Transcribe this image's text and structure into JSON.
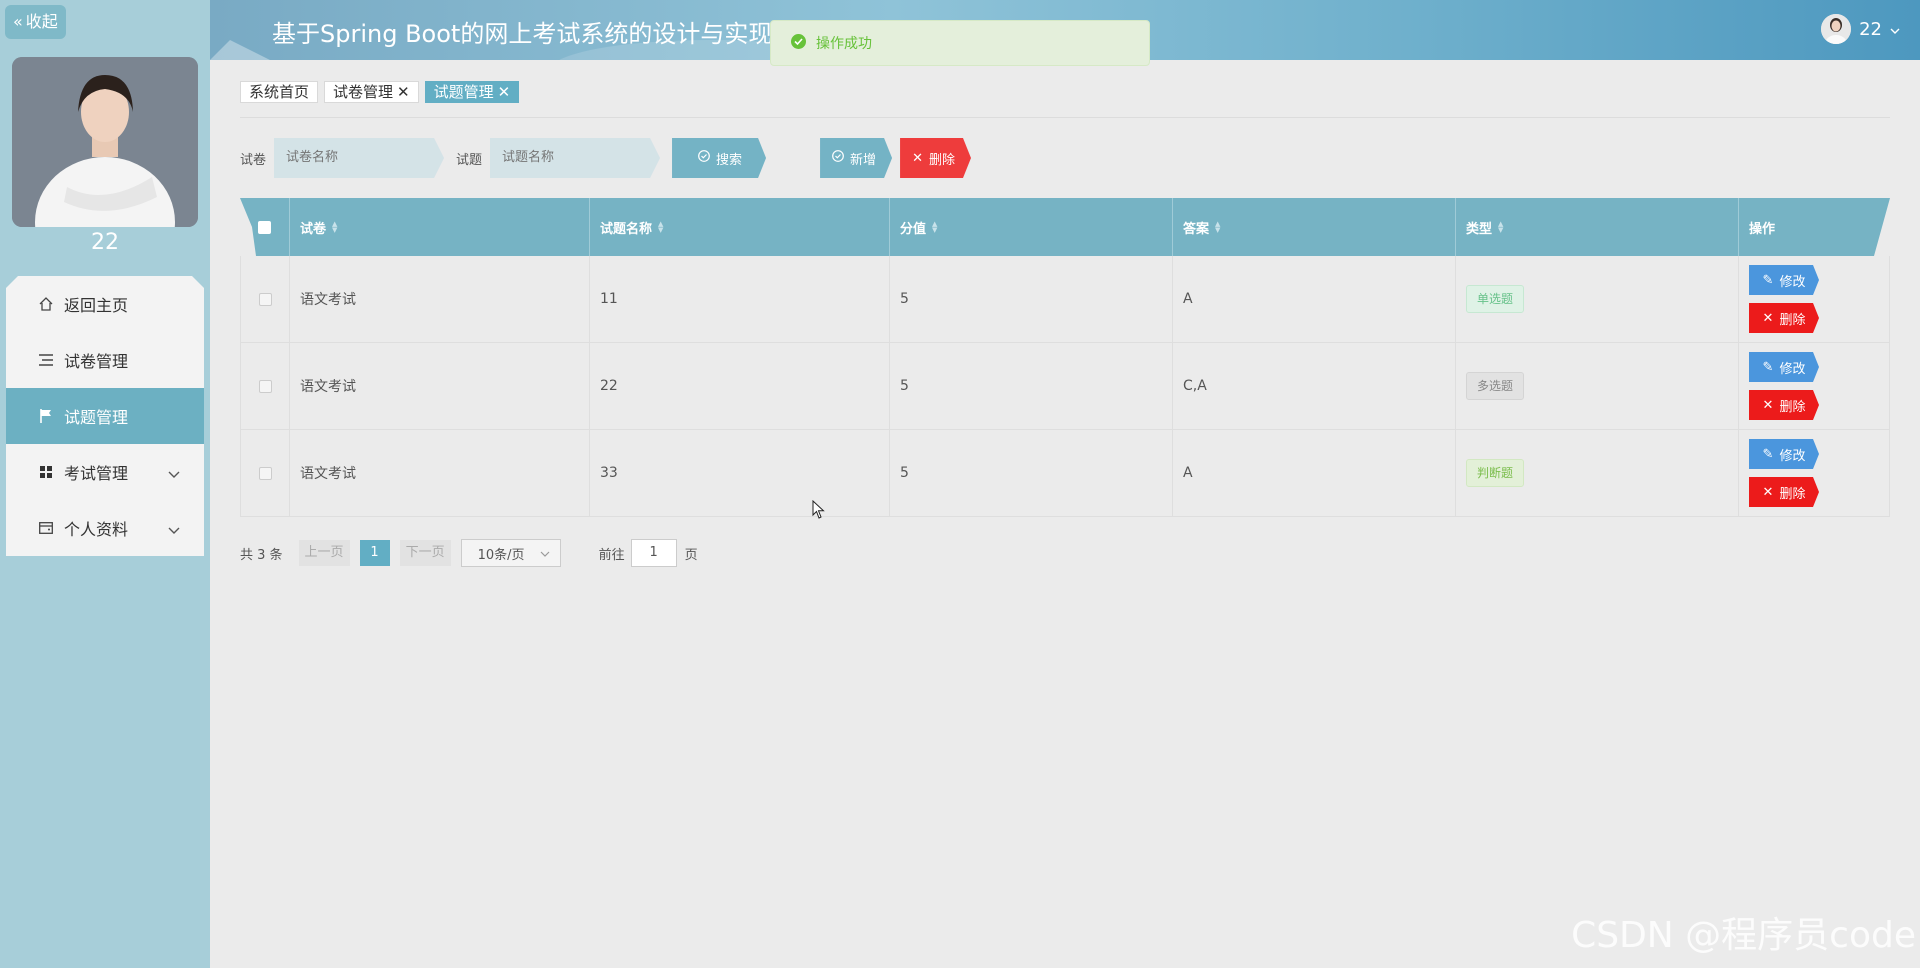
{
  "sidebar": {
    "collapse_label": "收起",
    "username": "22",
    "items": [
      {
        "label": "返回主页",
        "icon": "home-icon"
      },
      {
        "label": "试卷管理",
        "icon": "list-icon"
      },
      {
        "label": "试题管理",
        "icon": "flag-icon",
        "active": true
      },
      {
        "label": "考试管理",
        "icon": "grid-icon",
        "expandable": true
      },
      {
        "label": "个人资料",
        "icon": "wallet-icon",
        "expandable": true
      }
    ]
  },
  "header": {
    "title": "基于Spring Boot的网上考试系统的设计与实现",
    "user_name": "22"
  },
  "toast": {
    "message": "操作成功"
  },
  "tags": [
    {
      "label": "系统首页"
    },
    {
      "label": "试卷管理"
    },
    {
      "label": "试题管理"
    }
  ],
  "search": {
    "paper_label": "试卷",
    "paper_placeholder": "试卷名称",
    "question_label": "试题",
    "question_placeholder": "试题名称",
    "search_btn": "搜索",
    "add_btn": "新增",
    "delete_btn": "删除"
  },
  "table": {
    "headers": [
      "试卷",
      "试题名称",
      "分值",
      "答案",
      "类型",
      "操作"
    ],
    "rows": [
      {
        "paper": "语文考试",
        "name": "11",
        "score": "5",
        "answer": "A",
        "type": "单选题"
      },
      {
        "paper": "语文考试",
        "name": "22",
        "score": "5",
        "answer": "C,A",
        "type": "多选题"
      },
      {
        "paper": "语文考试",
        "name": "33",
        "score": "5",
        "answer": "A",
        "type": "判断题"
      }
    ],
    "edit_label": "修改",
    "delete_label": "删除"
  },
  "pager": {
    "total": "共 3 条",
    "prev": "上一页",
    "current": "1",
    "next": "下一页",
    "size": "10条/页",
    "goto_label": "前往",
    "goto_value": "1",
    "page_unit": "页"
  },
  "watermark": "CSDN @程序员code"
}
